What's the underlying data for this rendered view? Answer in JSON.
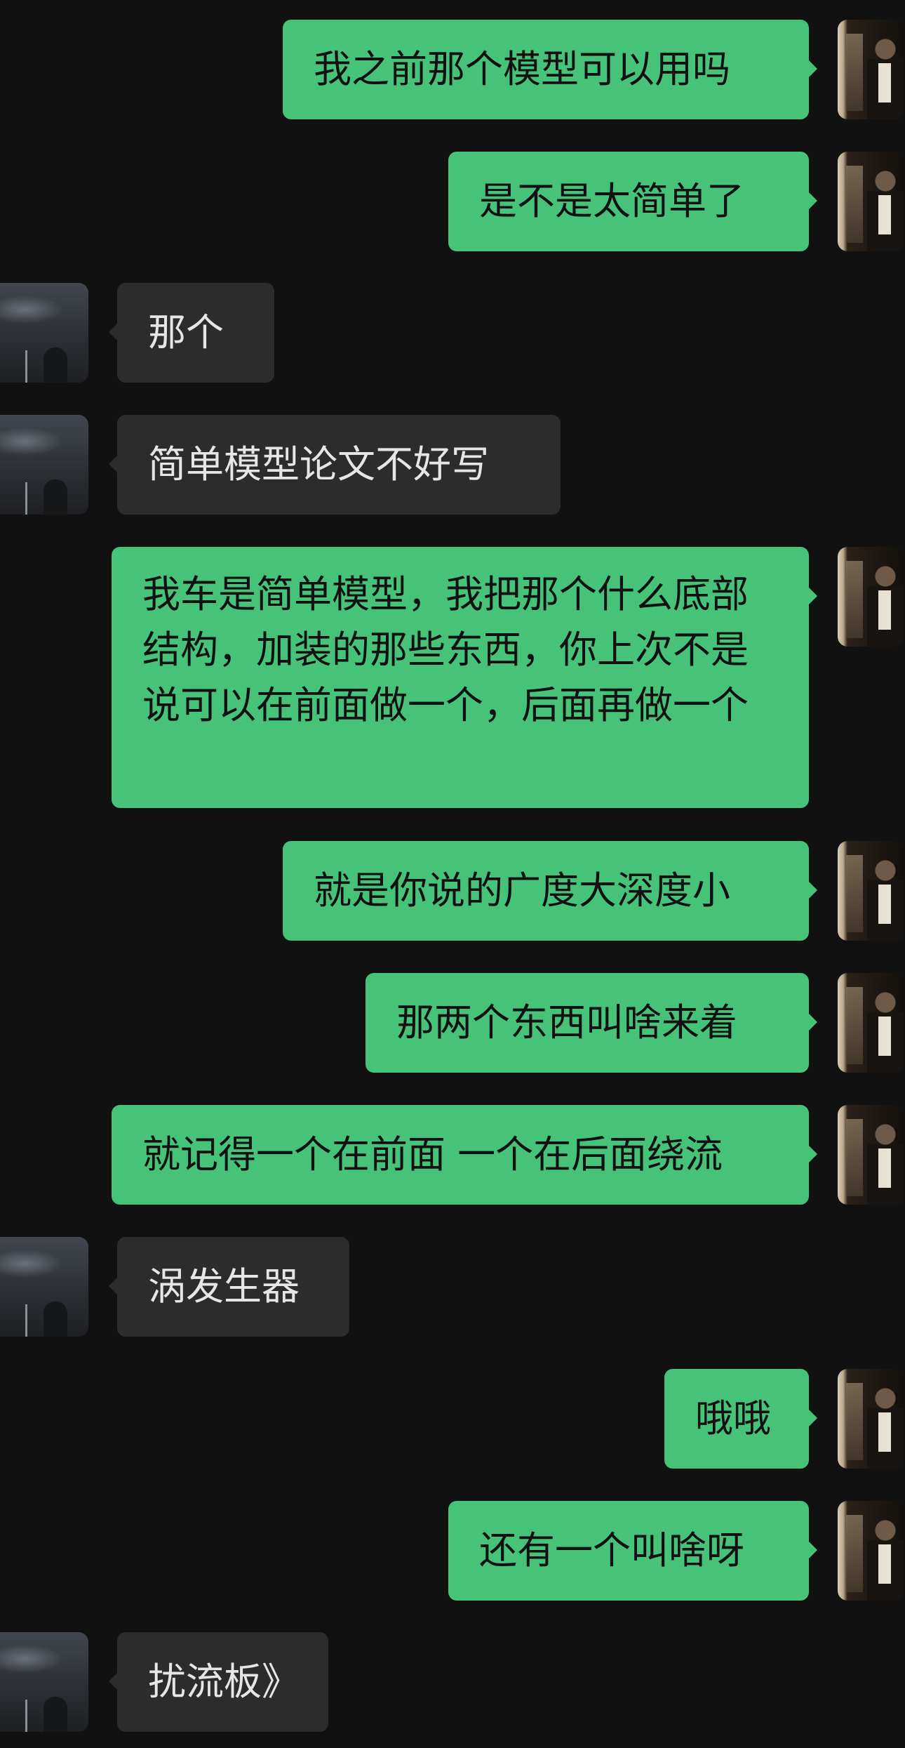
{
  "conversation": {
    "messages": [
      {
        "side": "right",
        "text": "我之前那个模型可以用吗"
      },
      {
        "side": "right",
        "text": "是不是太简单了"
      },
      {
        "side": "left",
        "text": "那个"
      },
      {
        "side": "left",
        "text": "简单模型论文不好写"
      },
      {
        "side": "right",
        "text": "我车是简单模型，我把那个什么底部结构，加装的那些东西，你上次不是说可以在前面做一个，后面再做一个"
      },
      {
        "side": "right",
        "text": "就是你说的广度大深度小"
      },
      {
        "side": "right",
        "text": "那两个东西叫啥来着"
      },
      {
        "side": "right",
        "text": "就记得一个在前面 一个在后面绕流"
      },
      {
        "side": "left",
        "text": "涡发生器"
      },
      {
        "side": "right",
        "text": "哦哦"
      },
      {
        "side": "right",
        "text": "还有一个叫啥呀"
      },
      {
        "side": "left",
        "text": "扰流板》"
      }
    ]
  },
  "colors": {
    "background": "#111111",
    "outgoing_bubble": "#47c379",
    "incoming_bubble": "#2c2c2c",
    "outgoing_text": "#111111",
    "incoming_text": "#e6e6e6"
  }
}
